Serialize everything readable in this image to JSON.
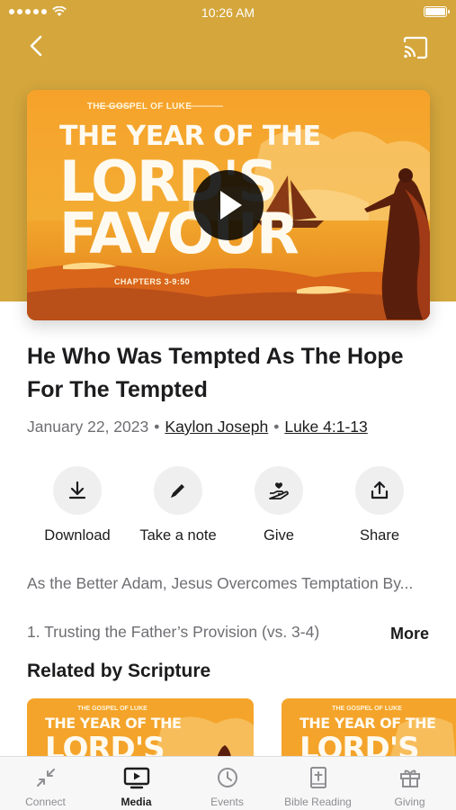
{
  "status_bar": {
    "time": "10:26 AM"
  },
  "header": {
    "back_icon": "chevron-left-icon",
    "cast_icon": "cast-icon"
  },
  "artwork": {
    "overline": "THE GOSPEL OF LUKE",
    "title_line1": "THE YEAR OF THE",
    "title_line2": "LORD'S",
    "title_line3": "FAVOUR",
    "chapters": "CHAPTERS 3-9:50",
    "play_icon": "play-icon"
  },
  "sermon": {
    "title": "He Who Was Tempted As The Hope For The Tempted",
    "date": "January 22, 2023",
    "speaker": "Kaylon Joseph",
    "scripture": "Luke 4:1-13",
    "separator": "•"
  },
  "actions": [
    {
      "label": "Download",
      "icon": "download-icon"
    },
    {
      "label": "Take a note",
      "icon": "pencil-icon"
    },
    {
      "label": "Give",
      "icon": "give-hand-heart-icon"
    },
    {
      "label": "Share",
      "icon": "share-icon"
    }
  ],
  "description": {
    "line1": "As the Better Adam, Jesus Overcomes Temptation By...",
    "line2": "1. Trusting the Father’s Provision (vs. 3-4)",
    "more_label": "More"
  },
  "related": {
    "heading": "Related by Scripture",
    "items": [
      {
        "overline": "THE GOSPEL OF LUKE",
        "title_line1": "THE YEAR OF THE",
        "title_line2": "LORD'S"
      },
      {
        "overline": "THE GOSPEL OF LUKE",
        "title_line1": "THE YEAR OF THE",
        "title_line2": "LORD'S"
      }
    ]
  },
  "tab_bar": {
    "tabs": [
      {
        "label": "Connect",
        "icon": "connect-arrows-icon",
        "active": false
      },
      {
        "label": "Media",
        "icon": "tv-play-icon",
        "active": true
      },
      {
        "label": "Events",
        "icon": "clock-icon",
        "active": false
      },
      {
        "label": "Bible Reading",
        "icon": "bible-icon",
        "active": false
      },
      {
        "label": "Giving",
        "icon": "gift-icon",
        "active": false
      }
    ]
  },
  "colors": {
    "hero_background": "#d4a63c",
    "artwork_orange": "#f0a020",
    "text_primary": "#1c1c1e",
    "text_secondary": "#6e6e73"
  }
}
